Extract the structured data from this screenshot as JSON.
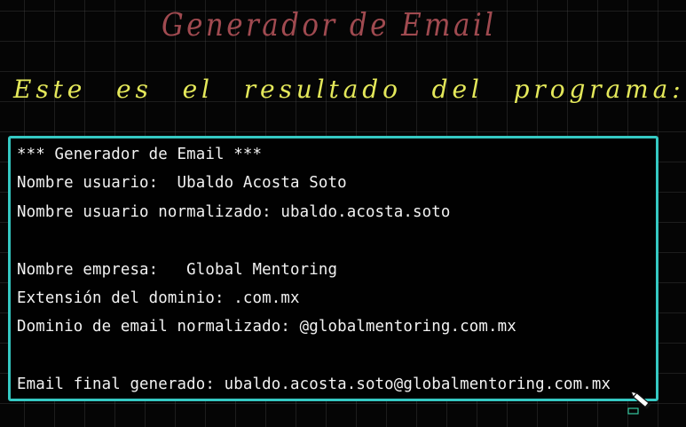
{
  "heading": {
    "title": "Generador de Email",
    "subtitle": "Este es el resultado del programa:"
  },
  "console": {
    "lines": [
      "*** Generador de Email ***",
      "Nombre usuario:  Ubaldo Acosta Soto",
      "Nombre usuario normalizado: ubaldo.acosta.soto",
      "",
      "Nombre empresa:   Global Mentoring",
      "Extensión del dominio: .com.mx",
      "Dominio de email normalizado: @globalmentoring.com.mx",
      "",
      "Email final generado: ubaldo.acosta.soto@globalmentoring.com.mx"
    ]
  },
  "icons": {
    "cursor": "pencil-icon"
  },
  "colors": {
    "background": "#050505",
    "grid": "#3a3a3a",
    "title": "#a04a50",
    "subtitle": "#e4e85a",
    "console_border": "#35c9c3",
    "console_text": "#f2f2f2"
  }
}
